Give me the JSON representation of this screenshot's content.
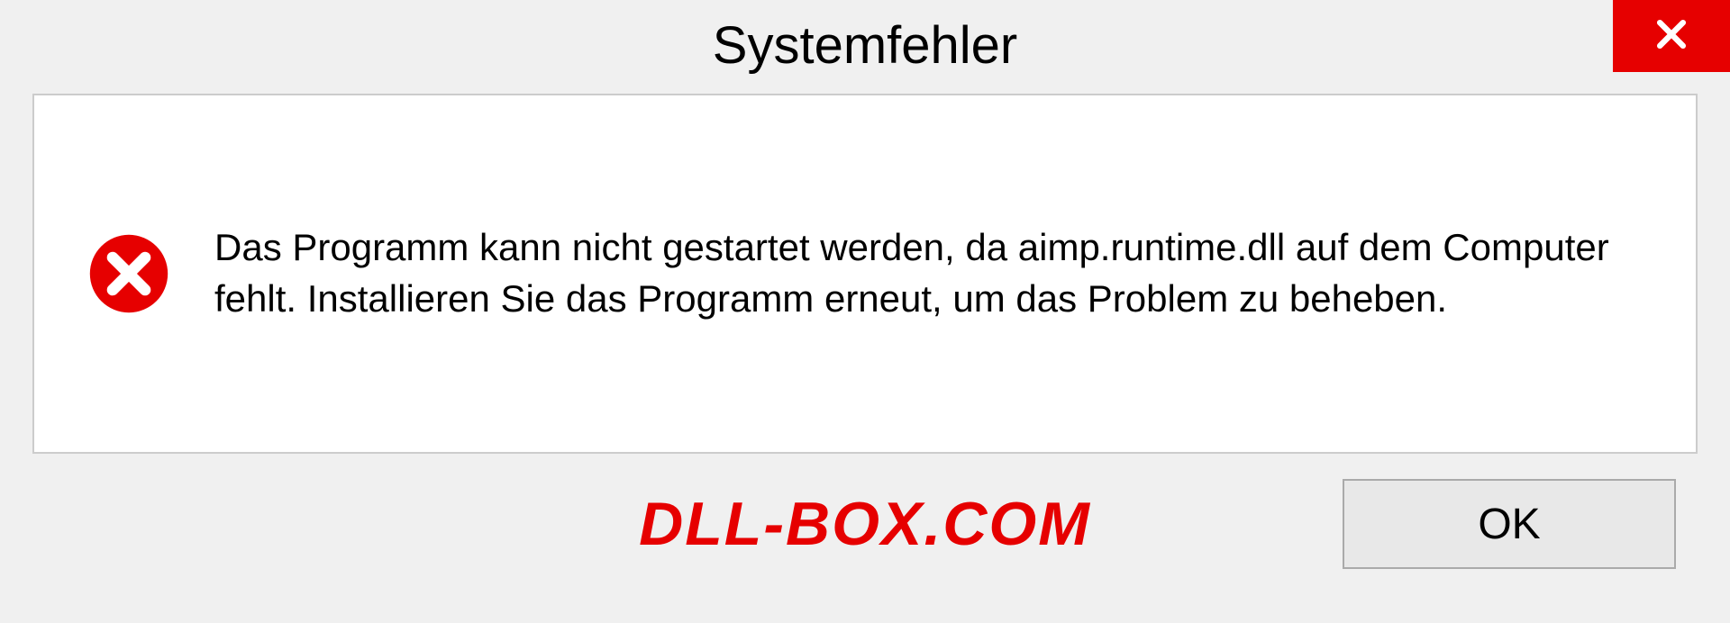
{
  "dialog": {
    "title": "Systemfehler",
    "message": "Das Programm kann nicht gestartet werden, da aimp.runtime.dll auf dem Computer fehlt. Installieren Sie das Programm erneut, um das Problem zu beheben.",
    "ok_label": "OK"
  },
  "watermark": "DLL-BOX.COM",
  "colors": {
    "close_bg": "#e60000",
    "error_icon": "#e60000",
    "watermark": "#e60000"
  }
}
